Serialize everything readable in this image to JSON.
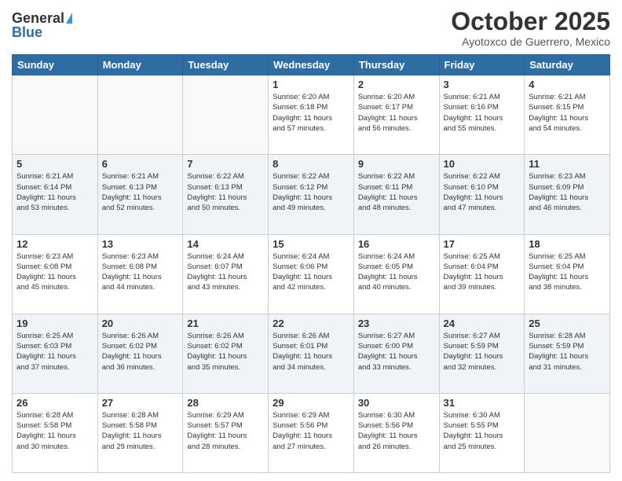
{
  "logo": {
    "general": "General",
    "blue": "Blue"
  },
  "title": "October 2025",
  "subtitle": "Ayotoxco de Guerrero, Mexico",
  "days_of_week": [
    "Sunday",
    "Monday",
    "Tuesday",
    "Wednesday",
    "Thursday",
    "Friday",
    "Saturday"
  ],
  "weeks": [
    [
      {
        "day": "",
        "info": ""
      },
      {
        "day": "",
        "info": ""
      },
      {
        "day": "",
        "info": ""
      },
      {
        "day": "1",
        "info": "Sunrise: 6:20 AM\nSunset: 6:18 PM\nDaylight: 11 hours\nand 57 minutes."
      },
      {
        "day": "2",
        "info": "Sunrise: 6:20 AM\nSunset: 6:17 PM\nDaylight: 11 hours\nand 56 minutes."
      },
      {
        "day": "3",
        "info": "Sunrise: 6:21 AM\nSunset: 6:16 PM\nDaylight: 11 hours\nand 55 minutes."
      },
      {
        "day": "4",
        "info": "Sunrise: 6:21 AM\nSunset: 6:15 PM\nDaylight: 11 hours\nand 54 minutes."
      }
    ],
    [
      {
        "day": "5",
        "info": "Sunrise: 6:21 AM\nSunset: 6:14 PM\nDaylight: 11 hours\nand 53 minutes."
      },
      {
        "day": "6",
        "info": "Sunrise: 6:21 AM\nSunset: 6:13 PM\nDaylight: 11 hours\nand 52 minutes."
      },
      {
        "day": "7",
        "info": "Sunrise: 6:22 AM\nSunset: 6:13 PM\nDaylight: 11 hours\nand 50 minutes."
      },
      {
        "day": "8",
        "info": "Sunrise: 6:22 AM\nSunset: 6:12 PM\nDaylight: 11 hours\nand 49 minutes."
      },
      {
        "day": "9",
        "info": "Sunrise: 6:22 AM\nSunset: 6:11 PM\nDaylight: 11 hours\nand 48 minutes."
      },
      {
        "day": "10",
        "info": "Sunrise: 6:22 AM\nSunset: 6:10 PM\nDaylight: 11 hours\nand 47 minutes."
      },
      {
        "day": "11",
        "info": "Sunrise: 6:23 AM\nSunset: 6:09 PM\nDaylight: 11 hours\nand 46 minutes."
      }
    ],
    [
      {
        "day": "12",
        "info": "Sunrise: 6:23 AM\nSunset: 6:08 PM\nDaylight: 11 hours\nand 45 minutes."
      },
      {
        "day": "13",
        "info": "Sunrise: 6:23 AM\nSunset: 6:08 PM\nDaylight: 11 hours\nand 44 minutes."
      },
      {
        "day": "14",
        "info": "Sunrise: 6:24 AM\nSunset: 6:07 PM\nDaylight: 11 hours\nand 43 minutes."
      },
      {
        "day": "15",
        "info": "Sunrise: 6:24 AM\nSunset: 6:06 PM\nDaylight: 11 hours\nand 42 minutes."
      },
      {
        "day": "16",
        "info": "Sunrise: 6:24 AM\nSunset: 6:05 PM\nDaylight: 11 hours\nand 40 minutes."
      },
      {
        "day": "17",
        "info": "Sunrise: 6:25 AM\nSunset: 6:04 PM\nDaylight: 11 hours\nand 39 minutes."
      },
      {
        "day": "18",
        "info": "Sunrise: 6:25 AM\nSunset: 6:04 PM\nDaylight: 11 hours\nand 38 minutes."
      }
    ],
    [
      {
        "day": "19",
        "info": "Sunrise: 6:25 AM\nSunset: 6:03 PM\nDaylight: 11 hours\nand 37 minutes."
      },
      {
        "day": "20",
        "info": "Sunrise: 6:26 AM\nSunset: 6:02 PM\nDaylight: 11 hours\nand 36 minutes."
      },
      {
        "day": "21",
        "info": "Sunrise: 6:26 AM\nSunset: 6:02 PM\nDaylight: 11 hours\nand 35 minutes."
      },
      {
        "day": "22",
        "info": "Sunrise: 6:26 AM\nSunset: 6:01 PM\nDaylight: 11 hours\nand 34 minutes."
      },
      {
        "day": "23",
        "info": "Sunrise: 6:27 AM\nSunset: 6:00 PM\nDaylight: 11 hours\nand 33 minutes."
      },
      {
        "day": "24",
        "info": "Sunrise: 6:27 AM\nSunset: 5:59 PM\nDaylight: 11 hours\nand 32 minutes."
      },
      {
        "day": "25",
        "info": "Sunrise: 6:28 AM\nSunset: 5:59 PM\nDaylight: 11 hours\nand 31 minutes."
      }
    ],
    [
      {
        "day": "26",
        "info": "Sunrise: 6:28 AM\nSunset: 5:58 PM\nDaylight: 11 hours\nand 30 minutes."
      },
      {
        "day": "27",
        "info": "Sunrise: 6:28 AM\nSunset: 5:58 PM\nDaylight: 11 hours\nand 29 minutes."
      },
      {
        "day": "28",
        "info": "Sunrise: 6:29 AM\nSunset: 5:57 PM\nDaylight: 11 hours\nand 28 minutes."
      },
      {
        "day": "29",
        "info": "Sunrise: 6:29 AM\nSunset: 5:56 PM\nDaylight: 11 hours\nand 27 minutes."
      },
      {
        "day": "30",
        "info": "Sunrise: 6:30 AM\nSunset: 5:56 PM\nDaylight: 11 hours\nand 26 minutes."
      },
      {
        "day": "31",
        "info": "Sunrise: 6:30 AM\nSunset: 5:55 PM\nDaylight: 11 hours\nand 25 minutes."
      },
      {
        "day": "",
        "info": ""
      }
    ]
  ]
}
